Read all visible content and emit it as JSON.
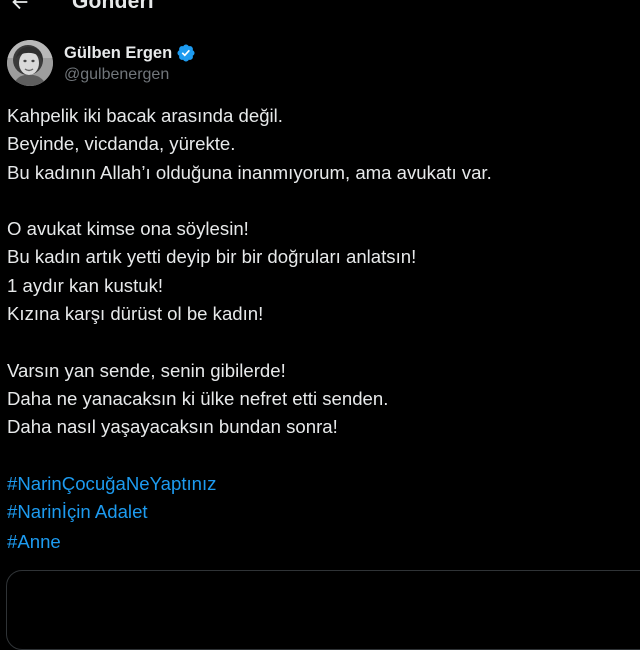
{
  "header": {
    "title": "Gönderi",
    "back_icon": "arrow-left-icon"
  },
  "author": {
    "display_name": "Gülben Ergen",
    "handle": "@gulbenergen",
    "verified_icon": "verified-badge-icon",
    "verified_color": "#1d9bf0"
  },
  "tweet": {
    "paragraph1": [
      "Kahpelik iki bacak arasında değil.",
      "Beyinde, vicdanda, yürekte.",
      "Bu kadının Allah’ı olduğuna inanmıyorum, ama avukatı var."
    ],
    "paragraph2": [
      "O avukat kimse ona söylesin!",
      "Bu kadın artık yetti deyip bir bir doğruları anlatsın!",
      "1 aydır kan kustuk!",
      "Kızına karşı dürüst ol be kadın!"
    ],
    "paragraph3": [
      "Varsın yan sende, senin gibilerde!",
      "Daha ne yanacaksın ki ülke nefret etti senden.",
      "Daha nasıl yaşayacaksın bundan sonra!"
    ],
    "hashtags": [
      "#NarinÇocuğaNeYaptınız",
      "#Narinİçin Adalet",
      "#Anne"
    ]
  },
  "colors": {
    "background": "#000000",
    "text": "#e7e9ea",
    "secondary": "#71767b",
    "link": "#1d9bf0",
    "border": "#2f3336"
  }
}
